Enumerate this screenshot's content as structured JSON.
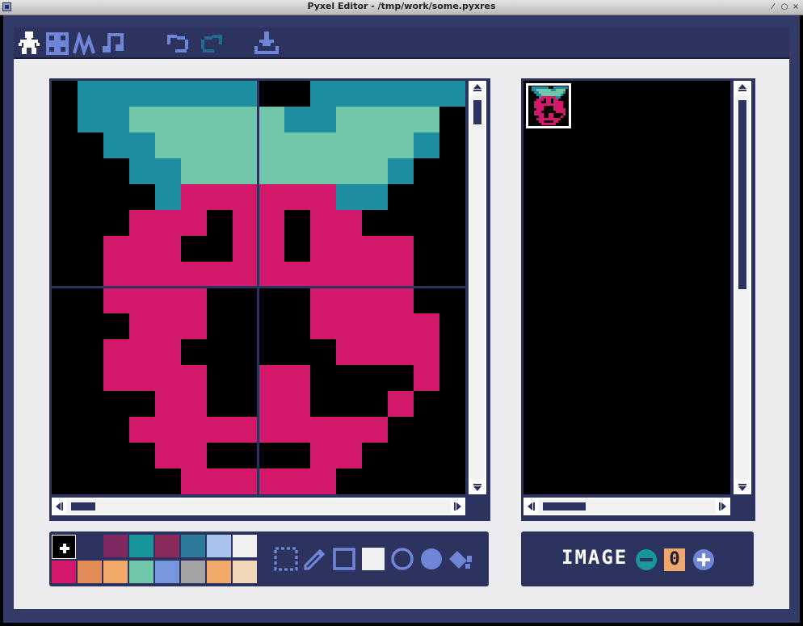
{
  "window": {
    "title": "Pyxel Editor - /tmp/work/some.pyxres",
    "controls": [
      "minimize-icon",
      "maximize-icon",
      "close-icon"
    ]
  },
  "menubar": {
    "editor_tabs": [
      "image-editor-icon",
      "tilemap-editor-icon",
      "sound-editor-icon",
      "music-editor-icon"
    ],
    "actions": [
      "undo-icon",
      "redo-icon",
      "save-icon"
    ]
  },
  "palette": {
    "colors": [
      "#000000",
      "#2b335f",
      "#7e2072",
      "#19959c",
      "#8b4852",
      "#395c98",
      "#a9c1ff",
      "#eeeeee",
      "#d4186c",
      "#d38441",
      "#e9c35b",
      "#70c6a9",
      "#7696de",
      "#a3a3a3",
      "#ff9798",
      "#edc7b0"
    ],
    "selected_index": 0,
    "display_colors": [
      "#000000",
      "#2c335f",
      "#7e2a60",
      "#19959c",
      "#8b2a5c",
      "#2e7a9a",
      "#a8c4ee",
      "#f0f0f0",
      "#d4186c",
      "#e38c58",
      "#f2a86a",
      "#70c6a9",
      "#7696de",
      "#a3a3a3",
      "#f2a86a",
      "#f2d6b8"
    ]
  },
  "tools": [
    "select-icon",
    "pencil-icon",
    "rect-outline-icon",
    "rect-fill-icon",
    "circle-outline-icon",
    "circle-fill-icon",
    "bucket-icon"
  ],
  "image_bank": {
    "label": "IMAGE",
    "number": "0"
  },
  "sprite": {
    "colors": [
      "#000000",
      "#1e8fa0",
      "#70c6a9",
      "#d4186c"
    ],
    "rows": [
      "0111111100111111",
      "0112222221122220",
      "0011222222222210",
      "0001122222222100",
      "0000133333311000",
      "0003330330330000",
      "0033300330333300",
      "0033333333333300",
      "0033330000333300",
      "0003330000333330",
      "0033300000033330",
      "0033330033000030",
      "0000330033000300",
      "0003333333333000",
      "0000330000330000",
      "0000033333300000"
    ]
  }
}
